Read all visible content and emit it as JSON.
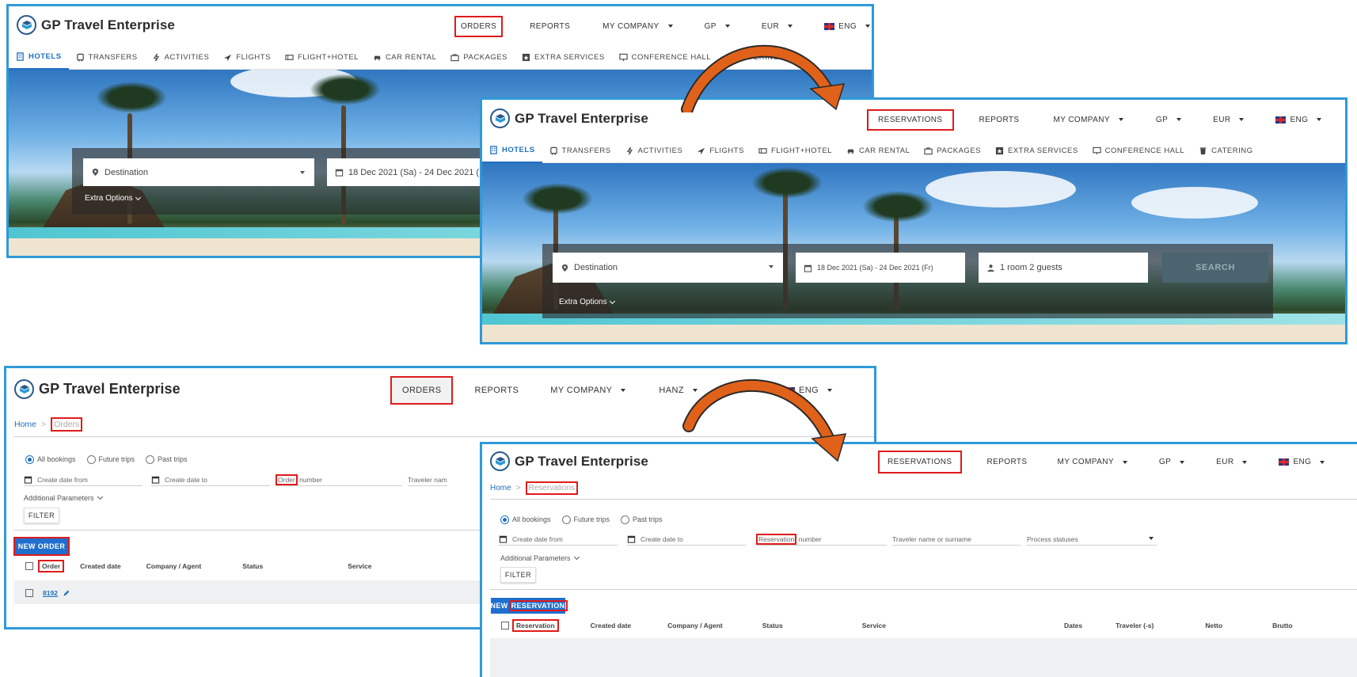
{
  "app": {
    "name": "GP Travel Enterprise"
  },
  "nav_before": {
    "orders": "ORDERS",
    "reports": "REPORTS",
    "company": "MY COMPANY",
    "user_gp": "GP",
    "user_hanz": "HANZ",
    "currency": "EUR",
    "lang": "ENG"
  },
  "nav_after": {
    "reservations": "RESERVATIONS",
    "reports": "REPORTS",
    "company": "MY COMPANY",
    "user": "GP",
    "currency": "EUR",
    "lang": "ENG"
  },
  "tabs": [
    "HOTELS",
    "TRANSFERS",
    "ACTIVITIES",
    "FLIGHTS",
    "FLIGHT+HOTEL",
    "CAR RENTAL",
    "PACKAGES",
    "EXTRA SERVICES",
    "CONFERENCE HALL",
    "CATERING"
  ],
  "search": {
    "destination_placeholder": "Destination",
    "dates": "18 Dec 2021 (Sa) -  24 Dec 2021 (Fr)",
    "guests": "1 room 2 guests",
    "search_button": "SEARCH",
    "extra_options": "Extra Options"
  },
  "orders_page": {
    "crumb_home": "Home",
    "crumb_sep": ">",
    "crumb_current": "Orders",
    "radio_all": "All bookings",
    "radio_future": "Future trips",
    "radio_past": "Past trips",
    "create_from": "Create date from",
    "create_to": "Create date to",
    "number_hl": "Order",
    "number_rest": " number",
    "traveler": "Traveler nam",
    "additional": "Additional Parameters",
    "filter": "FILTER",
    "new_button": "NEW ORDER",
    "col_order": "Order",
    "col_created": "Created date",
    "col_company": "Company / Agent",
    "col_status": "Status",
    "col_service": "Service",
    "row_number": "8192"
  },
  "reservations_page": {
    "crumb_home": "Home",
    "crumb_sep": ">",
    "crumb_current": "Reservations",
    "radio_all": "All bookings",
    "radio_future": "Future trips",
    "radio_past": "Past trips",
    "create_from": "Create date from",
    "create_to": "Create date to",
    "number_hl": "Reservation",
    "number_rest": " number",
    "traveler": "Traveler name or surname",
    "process": "Process statuses",
    "additional": "Additional Parameters",
    "filter": "FILTER",
    "new_prefix": "NEW ",
    "new_hl": "RESERVATION",
    "col_reservation": "Reservation",
    "col_created": "Created date",
    "col_company": "Company / Agent",
    "col_status": "Status",
    "col_service": "Service",
    "col_dates": "Dates",
    "col_traveler": "Traveler (-s)",
    "col_netto": "Netto",
    "col_brutto": "Brutto"
  },
  "colors": {
    "frame": "#2e9ad8",
    "highlight": "#e01b1b",
    "accent": "#1f6fcf",
    "arrow": "#e0621a"
  }
}
